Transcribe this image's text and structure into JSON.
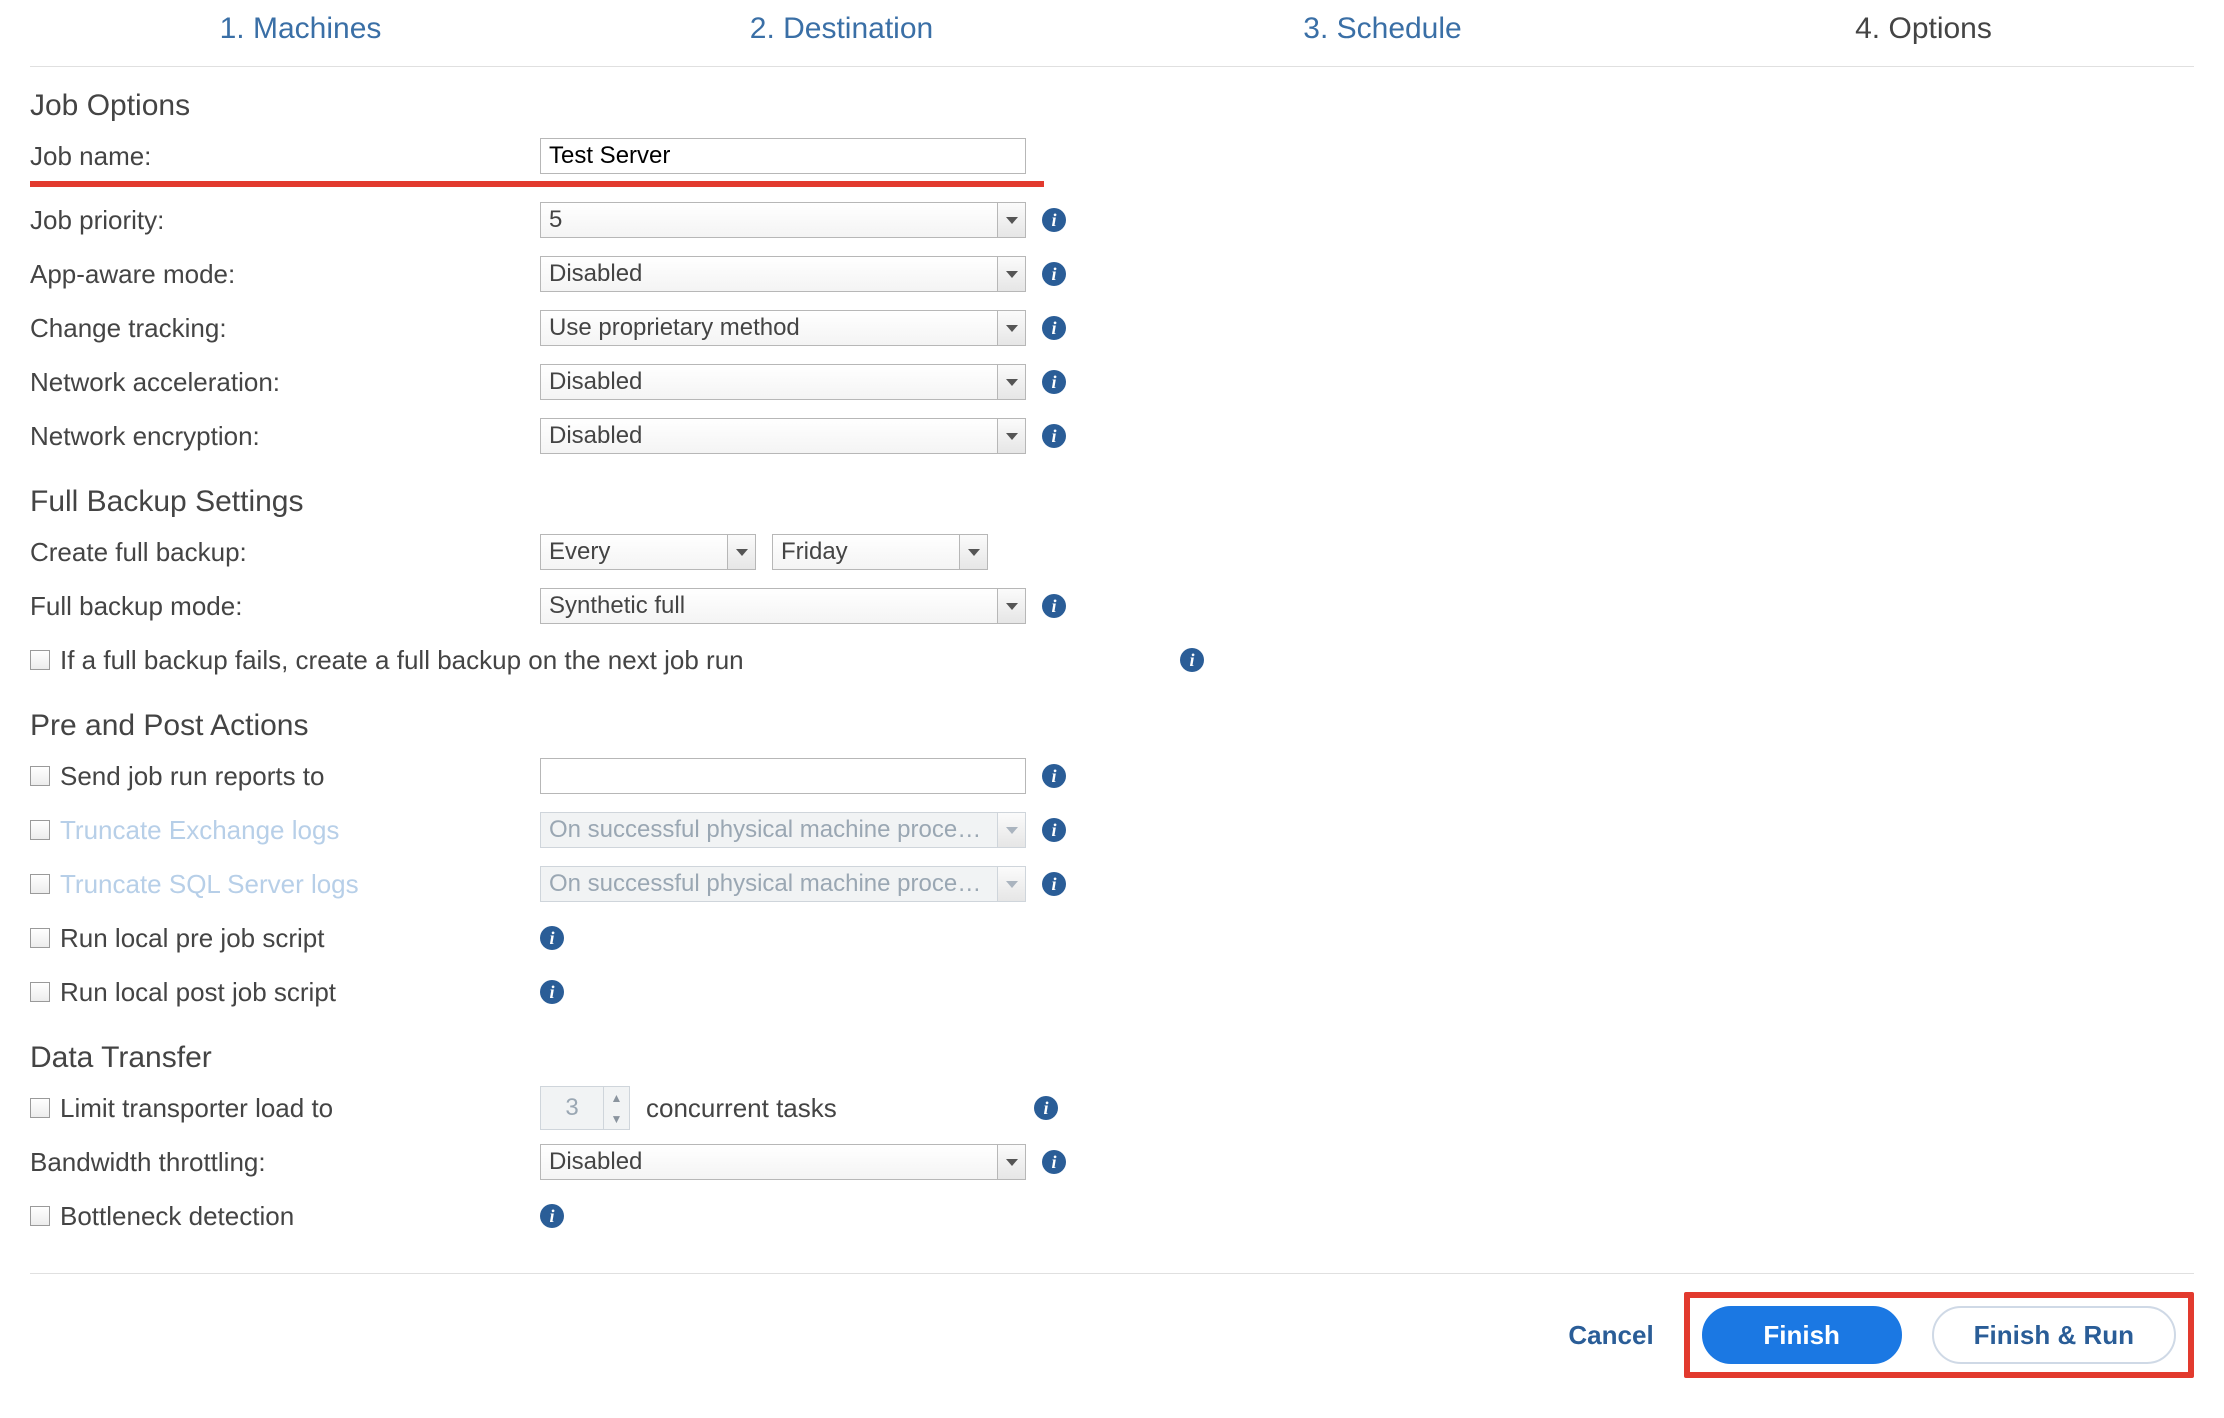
{
  "wizard": {
    "tabs": [
      {
        "label": "1. Machines",
        "active": false
      },
      {
        "label": "2. Destination",
        "active": false
      },
      {
        "label": "3. Schedule",
        "active": false
      },
      {
        "label": "4. Options",
        "active": true
      }
    ]
  },
  "sections": {
    "job_options": {
      "title": "Job Options",
      "job_name_label": "Job name:",
      "job_name_value": "Test Server",
      "job_priority_label": "Job priority:",
      "job_priority_value": "5",
      "app_aware_label": "App-aware mode:",
      "app_aware_value": "Disabled",
      "change_tracking_label": "Change tracking:",
      "change_tracking_value": "Use proprietary method",
      "network_accel_label": "Network acceleration:",
      "network_accel_value": "Disabled",
      "network_encrypt_label": "Network encryption:",
      "network_encrypt_value": "Disabled"
    },
    "full_backup": {
      "title": "Full Backup Settings",
      "create_full_label": "Create full backup:",
      "create_full_freq": "Every",
      "create_full_day": "Friday",
      "mode_label": "Full backup mode:",
      "mode_value": "Synthetic full",
      "retry_label": "If a full backup fails, create a full backup on the next job run"
    },
    "pre_post": {
      "title": "Pre and Post Actions",
      "send_reports_label": "Send job run reports to",
      "send_reports_value": "",
      "trunc_exchange_label": "Truncate Exchange logs",
      "trunc_exchange_value": "On successful physical machine processing",
      "trunc_sql_label": "Truncate SQL Server logs",
      "trunc_sql_value": "On successful physical machine processing",
      "pre_script_label": "Run local pre job script",
      "post_script_label": "Run local post job script"
    },
    "data_transfer": {
      "title": "Data Transfer",
      "limit_label": "Limit transporter load to",
      "limit_value": "3",
      "limit_suffix": "concurrent tasks",
      "bandwidth_label": "Bandwidth throttling:",
      "bandwidth_value": "Disabled",
      "bottleneck_label": "Bottleneck detection"
    }
  },
  "footer": {
    "cancel": "Cancel",
    "finish": "Finish",
    "finish_run": "Finish & Run"
  },
  "glyph": {
    "info": "i"
  }
}
